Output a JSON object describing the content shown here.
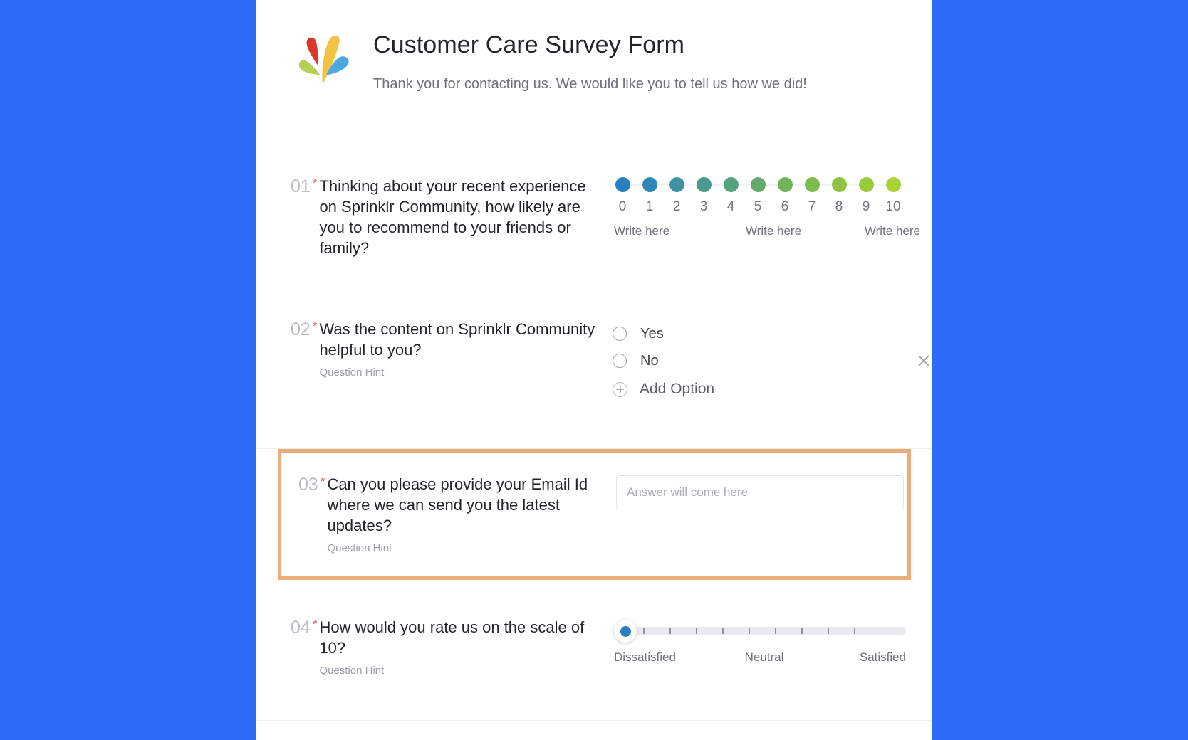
{
  "page": {
    "background_color": "#2b6cf6",
    "sheet_background": "#ffffff"
  },
  "header": {
    "logo_name": "sprinklr-logo",
    "title": "Customer Care Survey Form",
    "subtitle": "Thank you for contacting us. We would like you to tell us how we did!"
  },
  "required_marker": "*",
  "questions": [
    {
      "number": "01",
      "text": "Thinking about your recent experience on Sprinklr Community, how likely are you to recommend to your friends or family?",
      "hint": "",
      "type": "nps",
      "scale": {
        "values": [
          "0",
          "1",
          "2",
          "3",
          "4",
          "5",
          "6",
          "7",
          "8",
          "9",
          "10"
        ],
        "colors": [
          "#2a7fc0",
          "#2f87b4",
          "#3f92a4",
          "#4a9a90",
          "#55a37c",
          "#63ab6a",
          "#71b359",
          "#7fbb4c",
          "#8dc342",
          "#9bcb3d",
          "#a8d338"
        ],
        "left_label": "Write here",
        "mid_label": "Write here",
        "right_label": "Write here"
      }
    },
    {
      "number": "02",
      "text": "Was the content on Sprinklr Community helpful to you?",
      "hint": "Question Hint",
      "type": "radio",
      "options": [
        {
          "label": "Yes",
          "removable": false
        },
        {
          "label": "No",
          "removable": true
        }
      ],
      "add_option_label": "Add Option",
      "remove_icon": "close-icon",
      "add_icon": "plus-circle-icon"
    },
    {
      "number": "03",
      "text": "Can you please provide your Email Id where we can send you the latest updates?",
      "hint": "Question Hint",
      "type": "text",
      "input_value": "",
      "input_placeholder": "Answer will come here",
      "highlighted": true,
      "highlight_color": "#eeac77"
    },
    {
      "number": "04",
      "text": "How would you rate us on the scale of 10?",
      "hint": "Question Hint",
      "type": "slider",
      "slider": {
        "value": 0,
        "min": 0,
        "max": 10,
        "ticks": 10,
        "handle_color": "#2a7fc0",
        "left_label": "Dissatisfied",
        "mid_label": "Neutral",
        "right_label": "Satisfied"
      }
    }
  ]
}
